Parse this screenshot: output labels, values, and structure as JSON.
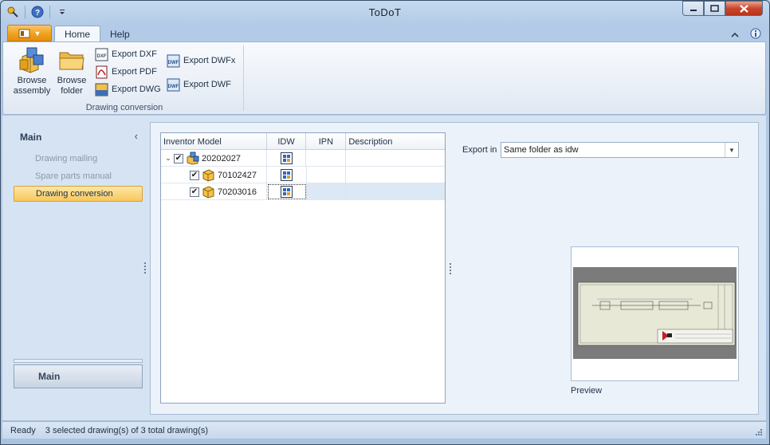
{
  "window": {
    "title": "ToDoT"
  },
  "title_controls": {
    "minimize": "▬",
    "maximize": "❐",
    "close": "✕"
  },
  "ribbon": {
    "tabs": [
      {
        "label": "Home",
        "active": true
      },
      {
        "label": "Help",
        "active": false
      }
    ],
    "group": {
      "label": "Drawing conversion",
      "large_buttons": [
        {
          "label_line1": "Browse",
          "label_line2": "assembly",
          "icon": "assembly-icon"
        },
        {
          "label_line1": "Browse",
          "label_line2": "folder",
          "icon": "folder-icon"
        }
      ],
      "small_buttons": [
        {
          "label": "Export DXF",
          "icon": "dxf-icon"
        },
        {
          "label": "Export PDF",
          "icon": "pdf-icon"
        },
        {
          "label": "Export DWG",
          "icon": "dwg-icon"
        },
        {
          "label": "Export DWFx",
          "icon": "dwfx-icon"
        },
        {
          "label": "Export DWF",
          "icon": "dwf-icon"
        }
      ]
    }
  },
  "nav": {
    "header": "Main",
    "items": [
      {
        "label": "Drawing mailing",
        "active": false
      },
      {
        "label": "Spare parts manual",
        "active": false
      },
      {
        "label": "Drawing conversion",
        "active": true
      }
    ],
    "bottom_button": "Main"
  },
  "tree": {
    "columns": [
      "Inventor Model",
      "IDW",
      "IPN",
      "Description"
    ],
    "rows": [
      {
        "model": "20202027",
        "level": 0,
        "checked": true,
        "type": "assembly",
        "idw": true,
        "ipn": "",
        "description": ""
      },
      {
        "model": "70102427",
        "level": 1,
        "checked": true,
        "type": "part",
        "idw": true,
        "ipn": "",
        "description": ""
      },
      {
        "model": "70203016",
        "level": 1,
        "checked": true,
        "type": "part",
        "idw": true,
        "ipn": "",
        "description": "",
        "selected": true
      }
    ]
  },
  "export": {
    "label": "Export in",
    "value": "Same folder as idw"
  },
  "preview": {
    "label": "Preview"
  },
  "status": {
    "state": "Ready",
    "message": "3 selected drawing(s) of 3 total drawing(s)"
  },
  "colors": {
    "accent_orange": "#f0a21e",
    "nav_active": "#f8c75c",
    "selection": "#dde8f5"
  }
}
